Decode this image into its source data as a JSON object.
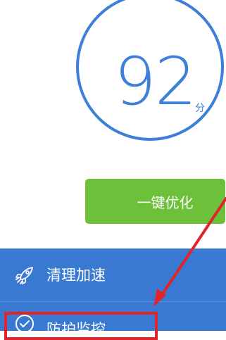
{
  "score": {
    "value": "92",
    "unit": "分"
  },
  "actions": {
    "optimize_label": "一键优化"
  },
  "menu": {
    "items": [
      {
        "label": "清理加速",
        "icon": "rocket-icon"
      },
      {
        "label": "防护监控",
        "icon": "shield-check-icon"
      }
    ]
  },
  "colors": {
    "accent_blue": "#3d7fd9",
    "menu_background": "#3a79d2",
    "button_green": "#6cc03a",
    "annotation_red": "#e0242a"
  }
}
